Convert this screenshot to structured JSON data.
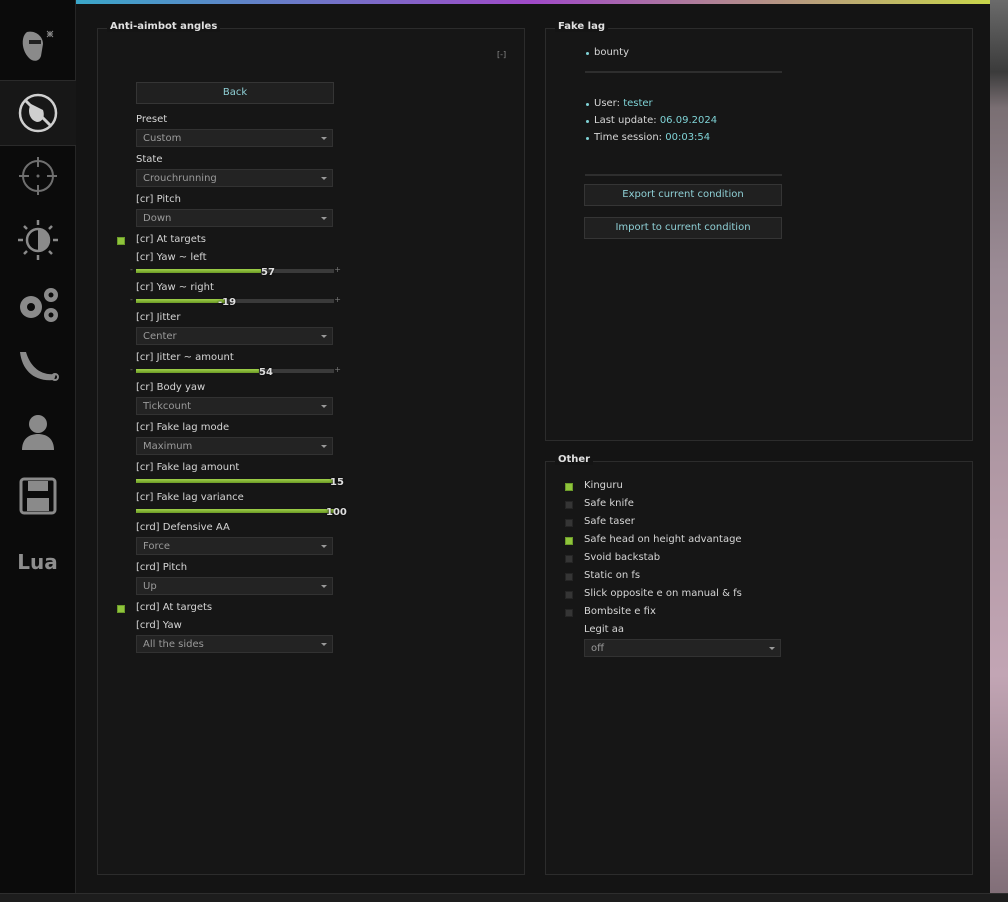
{
  "sidebar": {
    "tabs": [
      {
        "icon": "masked-face-icon",
        "active": false
      },
      {
        "icon": "anti-aimbot-icon",
        "active": true
      },
      {
        "icon": "crosshair-icon",
        "active": false
      },
      {
        "icon": "visuals-icon",
        "active": false
      },
      {
        "icon": "gears-icon",
        "active": false
      },
      {
        "icon": "knife-icon",
        "active": false
      },
      {
        "icon": "player-icon",
        "active": false
      },
      {
        "icon": "save-icon",
        "active": false
      },
      {
        "icon": "lua-icon",
        "label": "Lua",
        "active": false
      }
    ]
  },
  "colors": {
    "accent_green": "#8fc43b",
    "accent_cyan": "#7fd3d6"
  },
  "aa": {
    "title": "Anti-aimbot angles",
    "collapse": "[-]",
    "back": "Back",
    "preset_label": "Preset",
    "preset_value": "Custom",
    "state_label": "State",
    "state_value": "Crouchrunning",
    "pitch_label": "[cr] Pitch",
    "pitch_value": "Down",
    "at_targets_label": "[cr] At targets",
    "at_targets_checked": true,
    "yaw_left_label": "[cr] Yaw ~ left",
    "yaw_left_value": "57",
    "yaw_right_label": "[cr] Yaw ~ right",
    "yaw_right_value": "-19",
    "jitter_label": "[cr] Jitter",
    "jitter_value": "Center",
    "jitter_amount_label": "[cr] Jitter ~ amount",
    "jitter_amount_value": "54",
    "body_yaw_label": "[cr] Body yaw",
    "body_yaw_value": "Tickcount",
    "fl_mode_label": "[cr] Fake lag mode",
    "fl_mode_value": "Maximum",
    "fl_amount_label": "[cr] Fake lag amount",
    "fl_amount_value": "15",
    "fl_variance_label": "[cr] Fake lag variance",
    "fl_variance_value": "100",
    "def_aa_label": "[crd] Defensive AA",
    "def_aa_value": "Force",
    "crd_pitch_label": "[crd] Pitch",
    "crd_pitch_value": "Up",
    "crd_at_targets_label": "[crd] At targets",
    "crd_at_targets_checked": true,
    "crd_yaw_label": "[crd] Yaw",
    "crd_yaw_value": "All the sides",
    "slider_fill": {
      "yaw_left": 0.63,
      "yaw_right": 0.45,
      "jitter_amount": 0.62,
      "fl_amount": 1.0,
      "fl_variance": 1.0
    }
  },
  "fakelag": {
    "title": "Fake lag",
    "script_name": "bounty",
    "user_label": "User:",
    "user_value": "tester",
    "update_label": "Last update:",
    "update_value": "06.09.2024",
    "session_label": "Time session:",
    "session_value": "00:03:54",
    "export_button": "Export current condition",
    "import_button": "Import to current condition"
  },
  "other": {
    "title": "Other",
    "items": [
      {
        "label": "Kinguru",
        "checked": true
      },
      {
        "label": "Safe knife",
        "checked": false
      },
      {
        "label": "Safe taser",
        "checked": false
      },
      {
        "label": "Safe head on height advantage",
        "checked": true
      },
      {
        "label": "Svoid backstab",
        "checked": false
      },
      {
        "label": "Static on fs",
        "checked": false
      },
      {
        "label": "Slick opposite e on manual & fs",
        "checked": false
      },
      {
        "label": "Bombsite e fix",
        "checked": false
      }
    ],
    "legit_label": "Legit aa",
    "legit_value": "off"
  }
}
